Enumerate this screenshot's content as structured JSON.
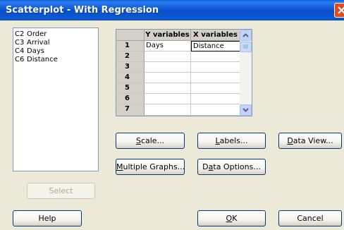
{
  "window": {
    "title": "Scatterplot - With Regression"
  },
  "variables_list": {
    "items": [
      {
        "column": "C2",
        "name": "Order"
      },
      {
        "column": "C3",
        "name": "Arrival"
      },
      {
        "column": "C4",
        "name": "Days"
      },
      {
        "column": "C6",
        "name": "Distance"
      }
    ]
  },
  "variables_grid": {
    "headers": [
      "Y variables",
      "X variables"
    ],
    "rows": [
      {
        "num": "1",
        "y": "Days",
        "x": "Distance"
      },
      {
        "num": "2",
        "y": "",
        "x": ""
      },
      {
        "num": "3",
        "y": "",
        "x": ""
      },
      {
        "num": "4",
        "y": "",
        "x": ""
      },
      {
        "num": "5",
        "y": "",
        "x": ""
      },
      {
        "num": "6",
        "y": "",
        "x": ""
      },
      {
        "num": "7",
        "y": "",
        "x": ""
      }
    ]
  },
  "buttons": {
    "scale": {
      "mnemonic": "S",
      "rest": "cale..."
    },
    "labels": {
      "mnemonic": "L",
      "rest": "abels..."
    },
    "data_view": {
      "mnemonic": "D",
      "rest": "ata View..."
    },
    "multiple_graphs": {
      "mnemonic": "M",
      "rest": "ultiple Graphs..."
    },
    "data_options": {
      "pre": "D",
      "mnemonic": "a",
      "rest": "ta Options..."
    },
    "select": "Select",
    "help": "Help",
    "ok": {
      "mnemonic": "O",
      "rest": "K"
    },
    "cancel": "Cancel"
  },
  "colors": {
    "titlebar": "#0a4fc8",
    "dialog_bg": "#ece9d8",
    "close_button": "#e34a21"
  }
}
